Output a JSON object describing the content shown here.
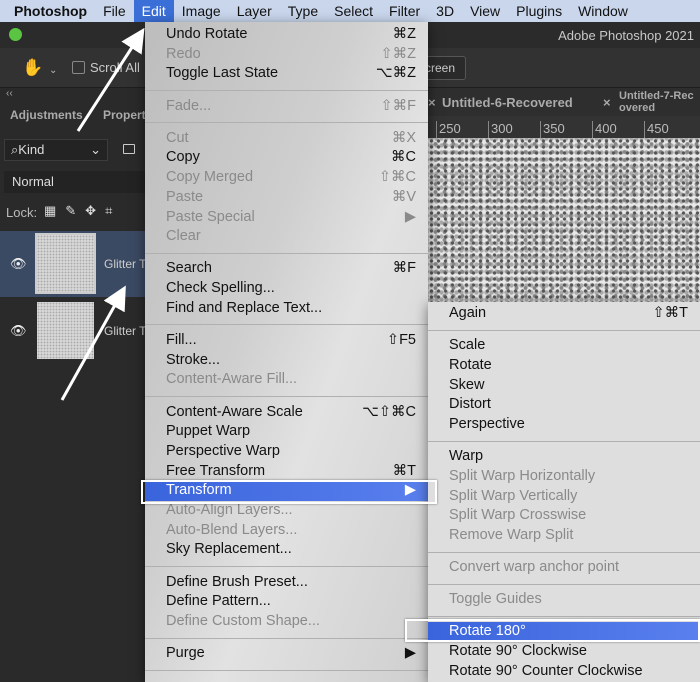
{
  "menubar": {
    "app": "Photoshop",
    "items": [
      "File",
      "Edit",
      "Image",
      "Layer",
      "Type",
      "Select",
      "Filter",
      "3D",
      "View",
      "Plugins",
      "Window"
    ]
  },
  "window_title": "Adobe Photoshop 2021",
  "options": {
    "scroll_all": "Scroll All",
    "screen_button": "Screen"
  },
  "panel": {
    "tabs": [
      "Adjustments",
      "Properties"
    ],
    "kind": "Kind",
    "blend": "Normal",
    "lock": "Lock:",
    "layers": [
      {
        "name": "Glitter Texture"
      },
      {
        "name": "Glitter Texture"
      }
    ]
  },
  "doc_tabs": [
    "Untitled-6-Recovered",
    "Untitled-7-Recovered"
  ],
  "ruler": [
    "250",
    "300",
    "350",
    "400",
    "450"
  ],
  "edit_menu": [
    {
      "label": "Undo Rotate",
      "sc": "⌘Z"
    },
    {
      "label": "Redo",
      "sc": "⇧⌘Z",
      "dis": true
    },
    {
      "label": "Toggle Last State",
      "sc": "⌥⌘Z"
    },
    {
      "sep": true
    },
    {
      "label": "Fade...",
      "sc": "⇧⌘F",
      "dis": true
    },
    {
      "sep": true
    },
    {
      "label": "Cut",
      "sc": "⌘X",
      "dis": true
    },
    {
      "label": "Copy",
      "sc": "⌘C"
    },
    {
      "label": "Copy Merged",
      "sc": "⇧⌘C",
      "dis": true
    },
    {
      "label": "Paste",
      "sc": "⌘V",
      "dis": true
    },
    {
      "label": "Paste Special",
      "sc": "▶",
      "dis": true
    },
    {
      "label": "Clear",
      "dis": true
    },
    {
      "sep": true
    },
    {
      "label": "Search",
      "sc": "⌘F"
    },
    {
      "label": "Check Spelling..."
    },
    {
      "label": "Find and Replace Text..."
    },
    {
      "sep": true
    },
    {
      "label": "Fill...",
      "sc": "⇧F5"
    },
    {
      "label": "Stroke..."
    },
    {
      "label": "Content-Aware Fill...",
      "dis": true
    },
    {
      "sep": true
    },
    {
      "label": "Content-Aware Scale",
      "sc": "⌥⇧⌘C"
    },
    {
      "label": "Puppet Warp"
    },
    {
      "label": "Perspective Warp"
    },
    {
      "label": "Free Transform",
      "sc": "⌘T"
    },
    {
      "label": "Transform",
      "sc": "▶",
      "hl": true
    },
    {
      "label": "Auto-Align Layers...",
      "dis": true
    },
    {
      "label": "Auto-Blend Layers...",
      "dis": true
    },
    {
      "label": "Sky Replacement..."
    },
    {
      "sep": true
    },
    {
      "label": "Define Brush Preset..."
    },
    {
      "label": "Define Pattern..."
    },
    {
      "label": "Define Custom Shape...",
      "dis": true
    },
    {
      "sep": true
    },
    {
      "label": "Purge",
      "sc": "▶"
    },
    {
      "sep": true
    }
  ],
  "transform_menu": [
    {
      "label": "Again",
      "sc": "⇧⌘T"
    },
    {
      "sep": true
    },
    {
      "label": "Scale"
    },
    {
      "label": "Rotate"
    },
    {
      "label": "Skew"
    },
    {
      "label": "Distort"
    },
    {
      "label": "Perspective"
    },
    {
      "sep": true
    },
    {
      "label": "Warp"
    },
    {
      "label": "Split Warp Horizontally",
      "dis": true
    },
    {
      "label": "Split Warp Vertically",
      "dis": true
    },
    {
      "label": "Split Warp Crosswise",
      "dis": true
    },
    {
      "label": "Remove Warp Split",
      "dis": true
    },
    {
      "sep": true
    },
    {
      "label": "Convert warp anchor point",
      "dis": true
    },
    {
      "sep": true
    },
    {
      "label": "Toggle Guides",
      "dis": true
    },
    {
      "sep": true
    },
    {
      "label": "Rotate 180°",
      "hl": true
    },
    {
      "label": "Rotate 90° Clockwise"
    },
    {
      "label": "Rotate 90° Counter Clockwise"
    }
  ]
}
